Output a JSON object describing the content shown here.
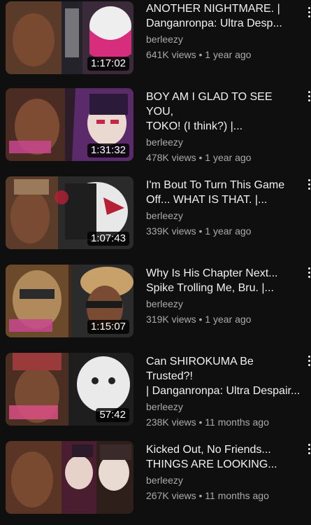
{
  "videos": [
    {
      "title": "ANOTHER NIGHTMARE. |\nDanganronpa: Ultra Desp...",
      "channel": "berleezy",
      "views": "641K views",
      "age": "1 year ago",
      "duration": "1:17:02",
      "thumb_colors": [
        "#2a2a33",
        "#d62d7c",
        "#f2f2f2"
      ]
    },
    {
      "title": "BOY AM I GLAD TO SEE YOU,\nTOKO! (I think?) |...",
      "channel": "berleezy",
      "views": "478K views",
      "age": "1 year ago",
      "duration": "1:31:32",
      "thumb_colors": [
        "#5a2a6a",
        "#c4264f",
        "#e9d9d0"
      ]
    },
    {
      "title": "I'm Bout To Turn This Game\nOff... WHAT IS THAT. |...",
      "channel": "berleezy",
      "views": "339K views",
      "age": "1 year ago",
      "duration": "1:07:43",
      "thumb_colors": [
        "#3b3b3b",
        "#b52035",
        "#e8e8e8"
      ]
    },
    {
      "title": "Why Is His Chapter Next...\nSpike Trolling Me, Bru. |...",
      "channel": "berleezy",
      "views": "319K views",
      "age": "1 year ago",
      "duration": "1:15:07",
      "thumb_colors": [
        "#6a4a2a",
        "#c8a06a",
        "#2b2b2b"
      ]
    },
    {
      "title": "Can SHIROKUMA Be Trusted?!\n| Danganronpa: Ultra Despair...",
      "channel": "berleezy",
      "views": "238K views",
      "age": "11 months ago",
      "duration": "57:42",
      "thumb_colors": [
        "#222222",
        "#d94f85",
        "#eaeaea"
      ]
    },
    {
      "title": "Kicked Out, No Friends...\nTHINGS ARE LOOKING...",
      "channel": "berleezy",
      "views": "267K views",
      "age": "11 months ago",
      "duration": "",
      "thumb_colors": [
        "#4a1e2e",
        "#c23a5a",
        "#2e1f1a"
      ]
    }
  ]
}
